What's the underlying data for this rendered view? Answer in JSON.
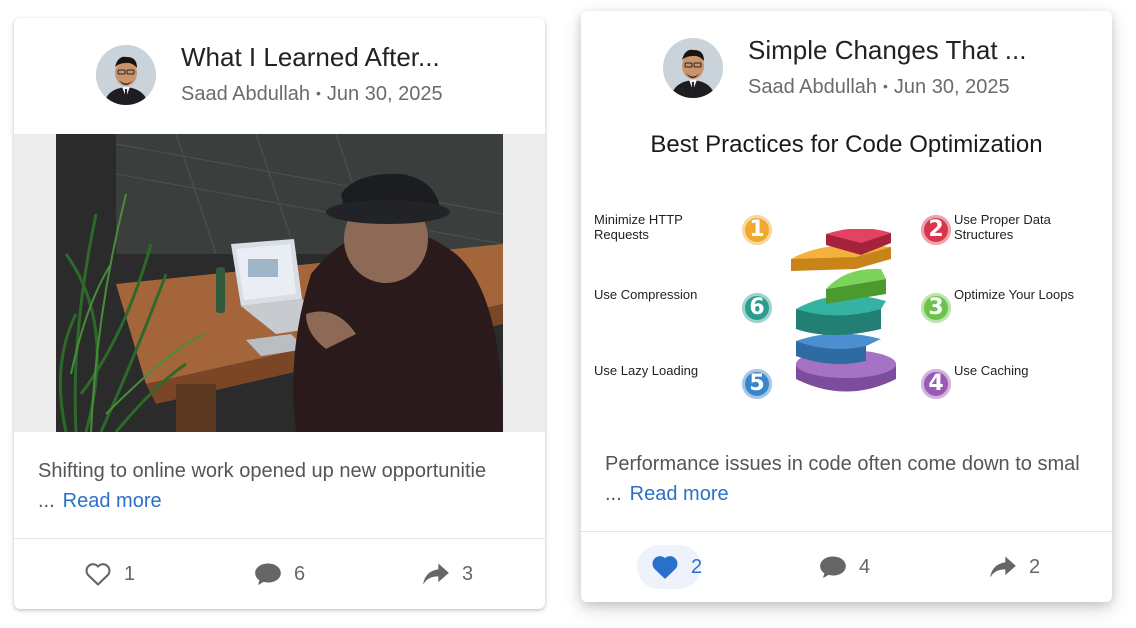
{
  "posts": [
    {
      "title": "What I Learned After...",
      "author": "Saad Abdullah",
      "date": "Jun 30, 2025",
      "separator": "•",
      "excerpt": "Shifting to online work opened up new opportunitie ...",
      "read_more": "Read more",
      "likes": "1",
      "comments": "6",
      "shares": "3",
      "liked": false
    },
    {
      "title": "Simple Changes That ...",
      "author": "Saad Abdullah",
      "date": "Jun 30, 2025",
      "separator": "•",
      "excerpt": "Performance issues in code often come down to smal ...",
      "read_more": "Read more",
      "likes": "2",
      "comments": "4",
      "shares": "2",
      "liked": true,
      "infographic": {
        "title": "Best Practices for Code Optimization",
        "tips": [
          {
            "num": "1",
            "text": "Minimize HTTP Requests",
            "color": "#f0a830"
          },
          {
            "num": "2",
            "text": "Use Proper Data Structures",
            "color": "#d8344a"
          },
          {
            "num": "3",
            "text": "Optimize Your Loops",
            "color": "#6cc24a"
          },
          {
            "num": "4",
            "text": "Use Caching",
            "color": "#9b59b6"
          },
          {
            "num": "5",
            "text": "Use Lazy Loading",
            "color": "#3a86c8"
          },
          {
            "num": "6",
            "text": "Use Compression",
            "color": "#2a9d8f"
          }
        ]
      }
    }
  ],
  "colors": {
    "link": "#2a6fc9",
    "liked": "#2a6fc9",
    "icon": "#666666"
  }
}
